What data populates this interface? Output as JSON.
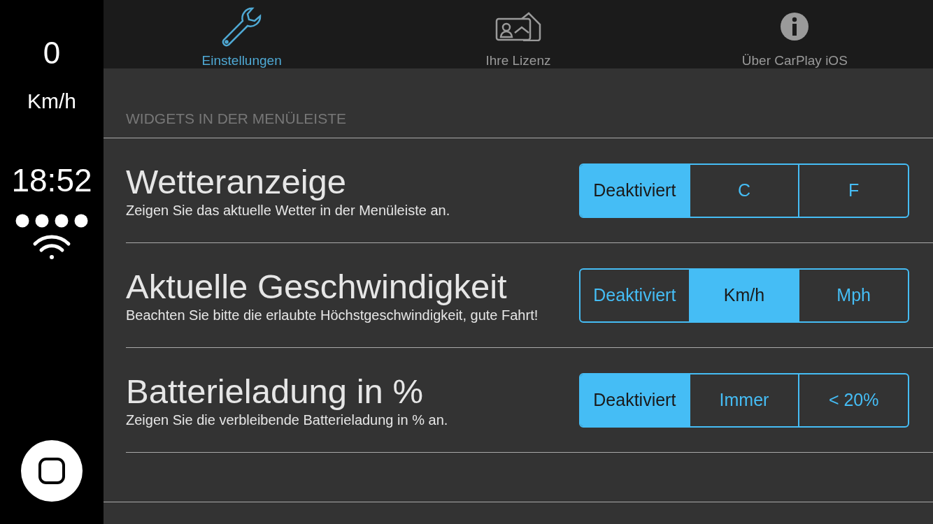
{
  "sidebar": {
    "speed": "0",
    "unit": "Km/h",
    "time": "18:52"
  },
  "tabs": [
    {
      "label": "Einstellungen",
      "selected": true,
      "kind": "wrench"
    },
    {
      "label": "Ihre Lizenz",
      "selected": false,
      "kind": "card"
    },
    {
      "label": "Über CarPlay iOS",
      "selected": false,
      "kind": "info"
    }
  ],
  "section_header": "WIDGETS IN DER MENÜLEISTE",
  "settings": [
    {
      "title": "Wetteranzeige",
      "description": "Zeigen Sie das aktuelle Wetter in der Menüleiste an.",
      "options": [
        {
          "label": "Deaktiviert",
          "selected": true
        },
        {
          "label": "C",
          "selected": false
        },
        {
          "label": "F",
          "selected": false
        }
      ]
    },
    {
      "title": "Aktuelle Geschwindigkeit",
      "description": "Beachten Sie bitte die erlaubte Höchstgeschwindigkeit, gute Fahrt!",
      "options": [
        {
          "label": "Deaktiviert",
          "selected": false
        },
        {
          "label": "Km/h",
          "selected": true
        },
        {
          "label": "Mph",
          "selected": false
        }
      ]
    },
    {
      "title": "Batterieladung in %",
      "description": "Zeigen Sie die verbleibende Batterieladung in % an.",
      "options": [
        {
          "label": "Deaktiviert",
          "selected": true
        },
        {
          "label": "Immer",
          "selected": false
        },
        {
          "label": "< 20%",
          "selected": false
        }
      ]
    }
  ]
}
